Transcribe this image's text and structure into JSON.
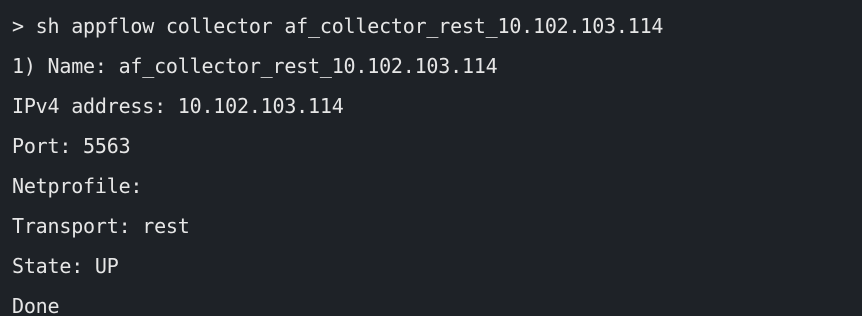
{
  "terminal": {
    "lines": [
      "> sh appflow collector af_collector_rest_10.102.103.114",
      "1) Name: af_collector_rest_10.102.103.114",
      "IPv4 address: 10.102.103.114",
      "Port: 5563",
      "Netprofile:",
      "Transport: rest",
      "State: UP",
      "Done"
    ]
  },
  "colors": {
    "background": "#1e2227",
    "text": "#e6e6e6"
  }
}
